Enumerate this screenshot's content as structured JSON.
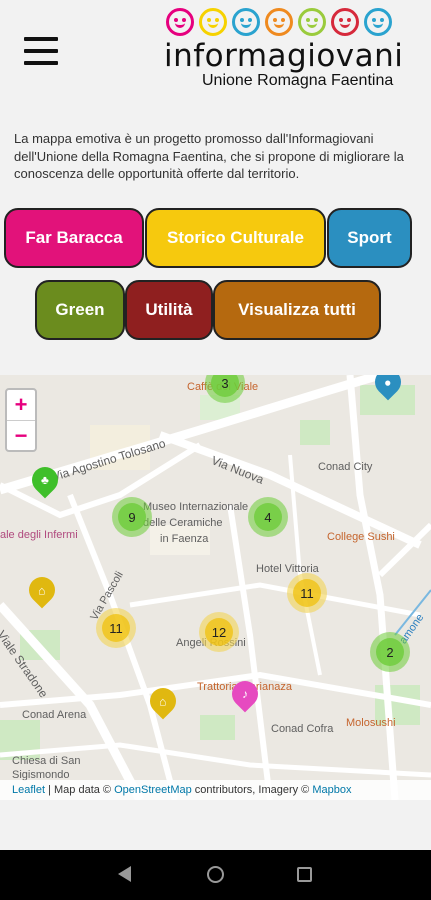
{
  "header": {
    "logo_title": "informagiovani",
    "logo_subtitle": "Unione Romagna Faentina",
    "face_colors": [
      "#e6007e",
      "#f6d200",
      "#2aa3cf",
      "#ef8a1f",
      "#9acb3c",
      "#d6293b",
      "#2aa3cf"
    ]
  },
  "intro": {
    "text": "La mappa emotiva è un progetto promosso dall'Informagiovani dell'Unione della Romagna Faentina, che si propone di migliorare la conoscenza delle opportunità offerte dal territorio."
  },
  "categories": [
    {
      "label": "Far Baracca",
      "color": "#e2127a"
    },
    {
      "label": "Storico Culturale",
      "color": "#f6c90e"
    },
    {
      "label": "Sport",
      "color": "#2b8fc0"
    },
    {
      "label": "Green",
      "color": "#6b8c1e"
    },
    {
      "label": "Utilità",
      "color": "#8f1f1f"
    },
    {
      "label": "Visualizza tutti",
      "color": "#b5690f"
    }
  ],
  "map": {
    "zoom_in": "+",
    "zoom_out": "−",
    "clusters": [
      {
        "count": "3",
        "color": "green"
      },
      {
        "count": "9",
        "color": "green"
      },
      {
        "count": "4",
        "color": "green"
      },
      {
        "count": "11",
        "color": "yellow"
      },
      {
        "count": "11",
        "color": "yellow"
      },
      {
        "count": "12",
        "color": "yellow"
      },
      {
        "count": "2",
        "color": "green"
      }
    ],
    "labels": {
      "via_tolosano": "Via Agostino Tolosano",
      "via_nuova": "Via Nuova",
      "conad_city": "Conad City",
      "museo_1": "Museo Internazionale",
      "museo_2": "delle Ceramiche",
      "museo_3": "in Faenza",
      "college_sushi": "College Sushi",
      "hotel_vittoria": "Hotel Vittoria",
      "viale_infermi": "ale degli Infermi",
      "via_pascoli": "Via Pascoli",
      "viale_stradone": "Viale Stradone",
      "angeli_rossini": "Angeli Rossini",
      "trattoria": "Trattoria Marianaza",
      "conad_arena": "Conad Arena",
      "conad_cofra": "Conad Cofra",
      "molosushi": "Molosushi",
      "chiesa_1": "Chiesa di San",
      "chiesa_2": "Sigismondo",
      "caffe_viale": "Caffè del Viale",
      "amone": "amone"
    },
    "attribution": {
      "leaflet": "Leaflet",
      "map_data": " | Map data © ",
      "osm": "OpenStreetMap",
      "contributors": " contributors, Imagery © ",
      "mapbox": "Mapbox"
    }
  }
}
